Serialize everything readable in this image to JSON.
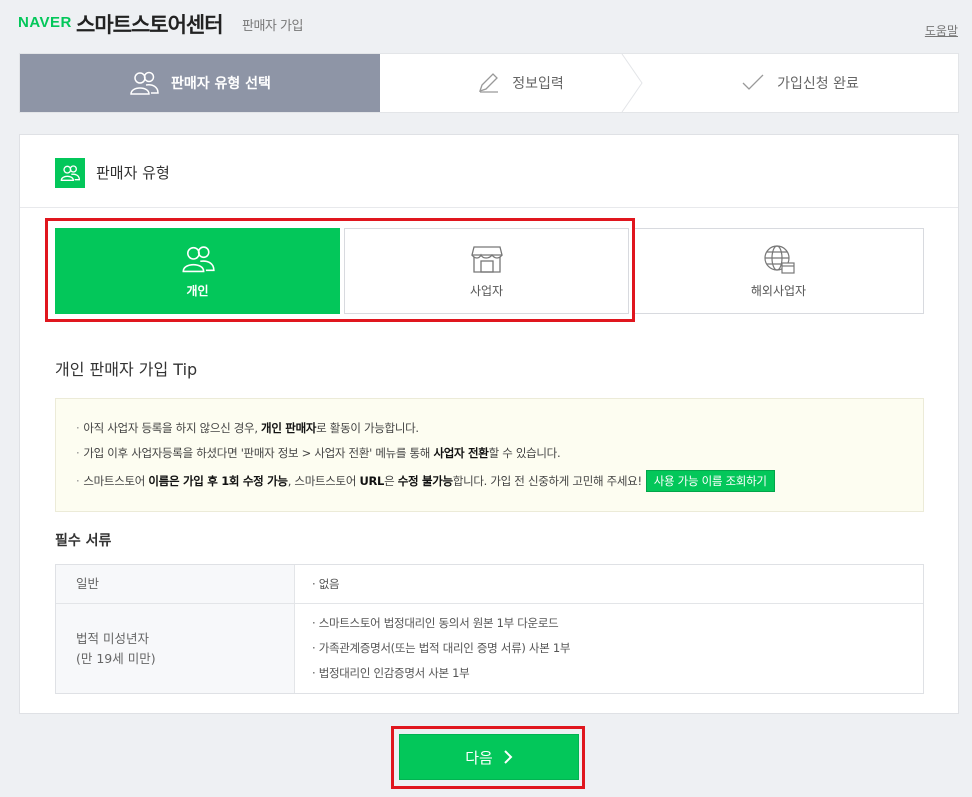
{
  "header": {
    "brand": "NAVER",
    "title": "스마트스토어센터",
    "subtitle": "판매자 가입",
    "help": "도움말"
  },
  "stepper": {
    "steps": [
      {
        "label": "판매자 유형 선택",
        "icon": "users-icon",
        "active": true
      },
      {
        "label": "정보입력",
        "icon": "pencil-icon",
        "active": false
      },
      {
        "label": "가입신청 완료",
        "icon": "check-icon",
        "active": false
      }
    ]
  },
  "section": {
    "title": "판매자 유형",
    "icon": "users-icon"
  },
  "seller_types": [
    {
      "label": "개인",
      "icon": "users-icon",
      "selected": true
    },
    {
      "label": "사업자",
      "icon": "store-icon",
      "selected": false
    },
    {
      "label": "해외사업자",
      "icon": "globe-store-icon",
      "selected": false
    }
  ],
  "tip": {
    "title": "개인 판매자 가입 Tip",
    "line1": {
      "a": "아직 사업자 등록을 하지 않으신 경우, ",
      "b": "개인 판매자",
      "c": "로 활동이 가능합니다."
    },
    "line2": {
      "a": "가입 이후 사업자등록을 하셨다면 '판매자 정보 > 사업자 전환' 메뉴를 통해 ",
      "b": "사업자 전환",
      "c": "할 수 있습니다."
    },
    "line3": {
      "a": "스마트스토어 ",
      "b": "이름은 가입 후 1회 수정 가능",
      "c": ", 스마트스토어 ",
      "d": "URL",
      "e": "은 ",
      "f": "수정 불가능",
      "g": "합니다. 가입 전 신중하게 고민해 주세요!",
      "button": "사용 가능 이름 조회하기"
    }
  },
  "docs": {
    "title": "필수 서류",
    "rows": [
      {
        "key": "일반",
        "values": [
          "없음"
        ]
      },
      {
        "key_line1": "법적 미성년자",
        "key_line2": "(만 19세 미만)",
        "values": [
          "스마트스토어 법정대리인 동의서 원본 1부 다운로드",
          "가족관계증명서(또는 법적 대리인 증명 서류) 사본 1부",
          "법정대리인 인감증명서 사본 1부"
        ]
      }
    ]
  },
  "next_button": {
    "label": "다음",
    "icon": "chevron-right-icon"
  },
  "colors": {
    "brand_green": "#03c75a",
    "step_active": "#8e95a6",
    "highlight_red": "#e0161e",
    "tip_bg": "#fdfdf1"
  }
}
